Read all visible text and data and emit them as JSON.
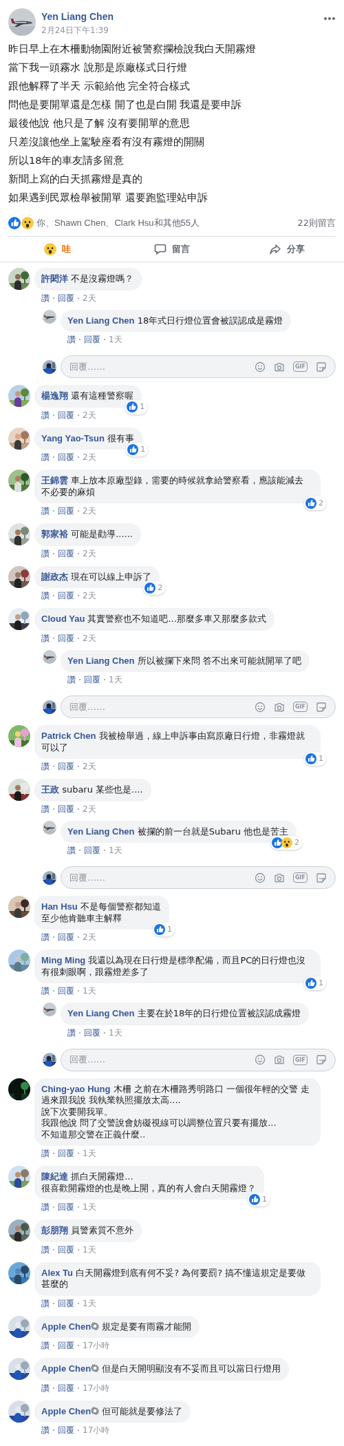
{
  "post": {
    "author": "Yen Liang Chen",
    "time": "2月24日下午1:39",
    "lines": [
      "昨日早上在木柵動物園附近被警察攔檢說我白天開霧燈",
      "當下我一頭霧水 說那是原廠樣式日行燈",
      "跟他解釋了半天 示範給他 完全符合樣式",
      "問他是要開單還是怎樣 開了也是白開 我還是要申訴",
      "最後他說 他只是了解 沒有要開單的意思",
      "只差沒讓他坐上駕駛座看有沒有霧燈的開關",
      "所以18年的車友請多留意",
      "新聞上寫的白天抓霧燈是真的",
      "如果遇到民眾檢舉被開單 還要跑監理站申訴"
    ],
    "reactions": [
      {
        "kind": "like"
      },
      {
        "kind": "wow"
      }
    ],
    "reaction_text": "你、Shawn Chen、Clark Hsu和其他55人",
    "comment_count": "22則留言"
  },
  "actions": [
    {
      "kind": "wow",
      "label": "哇",
      "selected": true
    },
    {
      "kind": "comment",
      "label": "留言",
      "selected": false
    },
    {
      "kind": "share",
      "label": "分享",
      "selected": false
    }
  ],
  "comments": [
    {
      "name": "許閎洋",
      "text": "不是沒霧燈嗎？",
      "like": "讚",
      "reply": "回覆",
      "time": "2天",
      "replies": [
        {
          "name": "Yen Liang Chen",
          "text": "18年式日行燈位置會被誤認成是霧燈",
          "like": "讚",
          "reply": "回覆",
          "time": "1天"
        }
      ],
      "reply_box": {
        "placeholder": "回覆……",
        "gif": "GIF"
      }
    },
    {
      "name": "楊逸翔",
      "text": "還有這種警察喔",
      "like": "讚",
      "reply": "回覆",
      "time": "2天",
      "reactions": [
        {
          "kind": "like"
        }
      ],
      "reaction_count": "1"
    },
    {
      "name": "Yang Yao-Tsun",
      "text": "很有事",
      "like": "讚",
      "reply": "回覆",
      "time": "2天",
      "reactions": [
        {
          "kind": "like"
        }
      ],
      "reaction_count": "1"
    },
    {
      "name": "王錦雲",
      "text": "車上放本原廠型錄，需要的時候就拿給警察看，應該能減去不必要的麻煩",
      "like": "讚",
      "reply": "回覆",
      "time": "2天",
      "reactions": [
        {
          "kind": "like"
        }
      ],
      "reaction_count": "2"
    },
    {
      "name": "郭家裕",
      "text": "可能是勸導......",
      "like": "讚",
      "reply": "回覆",
      "time": "2天"
    },
    {
      "name": "謝政杰",
      "text": "現在可以線上申訴了",
      "like": "讚",
      "reply": "回覆",
      "time": "2天",
      "reactions": [
        {
          "kind": "like"
        }
      ],
      "reaction_count": "2"
    },
    {
      "name": "Cloud Yau",
      "text": "其實警察也不知道吧...那麼多車又那麼多款式",
      "like": "讚",
      "reply": "回覆",
      "time": "2天",
      "replies": [
        {
          "name": "Yen Liang Chen",
          "text": "所以被攔下來問 答不出來可能就開單了吧",
          "like": "讚",
          "reply": "回覆",
          "time": "1天"
        }
      ],
      "reply_box": {
        "placeholder": "回覆……",
        "gif": "GIF"
      }
    },
    {
      "name": "Patrick Chen",
      "text": "我被檢舉過，線上申訴事由寫原廠日行燈，非霧燈就可以了",
      "like": "讚",
      "reply": "回覆",
      "time": "2天",
      "reactions": [
        {
          "kind": "like"
        }
      ],
      "reaction_count": "1"
    },
    {
      "name": "王政",
      "text": "subaru 某些也是....",
      "like": "讚",
      "reply": "回覆",
      "time": "2天",
      "replies": [
        {
          "name": "Yen Liang Chen",
          "text": "被攔的前一台就是Subaru 他也是苦主",
          "like": "讚",
          "reply": "回覆",
          "time": "1天",
          "reactions": [
            {
              "kind": "like"
            },
            {
              "kind": "wow"
            }
          ],
          "reaction_count": "2"
        }
      ],
      "reply_box": {
        "placeholder": "回覆……",
        "gif": "GIF"
      }
    },
    {
      "name": "Han Hsu",
      "text": "不是每個警察都知道",
      "more_lines": [
        "至少他肯聽車主解釋"
      ],
      "like": "讚",
      "reply": "回覆",
      "time": "2天",
      "reactions": [
        {
          "kind": "like"
        }
      ],
      "reaction_count": "1"
    },
    {
      "name": "Ming Ming",
      "text": "我還以為現在日行燈是標準配備，而且PC的日行燈也沒有很刺眼啊，跟霧燈差多了",
      "like": "讚",
      "reply": "回覆",
      "time": "1天",
      "reactions": [
        {
          "kind": "like"
        }
      ],
      "reaction_count": "1",
      "replies": [
        {
          "name": "Yen Liang Chen",
          "text": "主要在於18年的日行燈位置被誤認成霧燈",
          "like": "讚",
          "reply": "回覆",
          "time": "1天"
        }
      ],
      "reply_box": {
        "placeholder": "回覆……",
        "gif": "GIF"
      }
    },
    {
      "name": "Ching-yao Hung",
      "text": "木柵 之前在木柵路秀明路口 一個很年輕的交警 走過來跟我說 我執業執照擺放太高....",
      "more_lines": [
        "說下次要開我單。",
        "我跟他說 問了交警說會妨礙視線可以調整位置只要有擺放...",
        "不知道那交警在正義什麼.."
      ],
      "like": "讚",
      "reply": "回覆",
      "time": "1天"
    },
    {
      "name": "陳紀達",
      "text": "抓白天開霧燈...",
      "more_lines": [
        "很喜歡開霧燈的也是晚上開，真的有人會白天開霧燈？"
      ],
      "like": "讚",
      "reply": "回覆",
      "time": "1天",
      "reactions": [
        {
          "kind": "like"
        }
      ],
      "reaction_count": "1"
    },
    {
      "name": "彭朋翔",
      "text": "員警素質不意外",
      "like": "讚",
      "reply": "回覆",
      "time": "1天"
    },
    {
      "name": "Alex Tu",
      "text": "白天開霧燈到底有何不妥? 為何要罰? 搞不懂這規定是要做甚麼的",
      "like": "讚",
      "reply": "回覆",
      "time": "1天"
    },
    {
      "name": "Apple Chen",
      "badge": true,
      "text": "規定是要有雨霧才能開",
      "like": "讚",
      "reply": "回覆",
      "time": "17小時"
    },
    {
      "name": "Apple Chen",
      "badge": true,
      "text": "但是白天開明顯沒有不妥而且可以當日行燈用",
      "like": "讚",
      "reply": "回覆",
      "time": "17小時"
    },
    {
      "name": "Apple Chen",
      "badge": true,
      "text": "但可能就是要修法了",
      "like": "讚",
      "reply": "回覆",
      "time": "17小時"
    }
  ]
}
